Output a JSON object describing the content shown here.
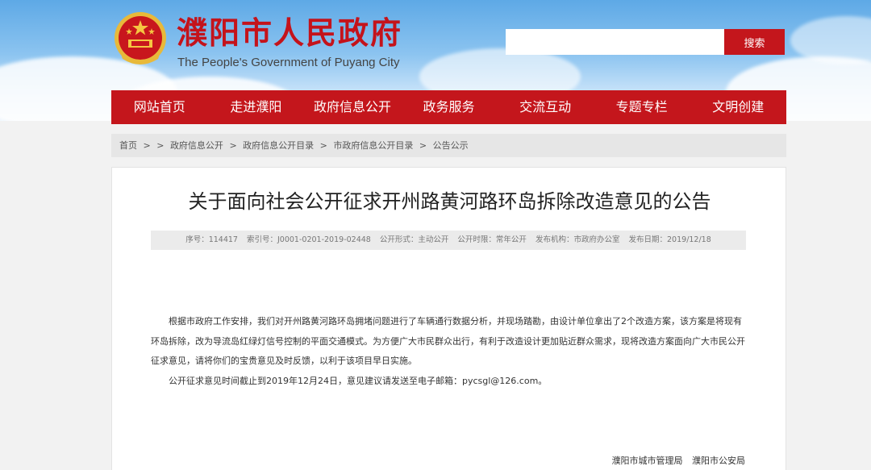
{
  "header": {
    "site_title": "濮阳市人民政府",
    "site_subtitle": "The People's Government of Puyang City",
    "search_placeholder": "",
    "search_button": "搜索"
  },
  "nav": {
    "items": [
      "网站首页",
      "走进濮阳",
      "政府信息公开",
      "政务服务",
      "交流互动",
      "专题专栏",
      "文明创建"
    ]
  },
  "breadcrumb": {
    "items": [
      "首页",
      ">",
      ">",
      "政府信息公开",
      ">",
      "政府信息公开目录",
      ">",
      "市政府信息公开目录",
      ">",
      "公告公示"
    ]
  },
  "article": {
    "title": "关于面向社会公开征求开州路黄河路环岛拆除改造意见的公告",
    "meta": {
      "serial": "序号：114417",
      "index": "索引号：J0001-0201-2019-02448",
      "form": "公开形式：主动公开",
      "time": "公开时限：常年公开",
      "agency": "发布机构：市政府办公室",
      "date": "发布日期：2019/12/18"
    },
    "paragraphs": [
      "根据市政府工作安排，我们对开州路黄河路环岛拥堵问题进行了车辆通行数据分析，并现场踏勘，由设计单位拿出了2个改造方案，该方案是将现有环岛拆除，改为导流岛红绿灯信号控制的平面交通模式。为方便广大市民群众出行，有利于改造设计更加贴近群众需求，现将改造方案面向广大市民公开征求意见，请将你们的宝贵意见及时反馈，以利于该项目早日实施。",
      "公开征求意见时间截止到2019年12月24日，意见建议请发送至电子邮箱：pycsgl@126.com。"
    ],
    "signature": [
      "濮阳市城市管理局",
      "濮阳市公安局"
    ]
  },
  "colors": {
    "brand_red": "#c4161c",
    "title_red": "#c4131b"
  }
}
